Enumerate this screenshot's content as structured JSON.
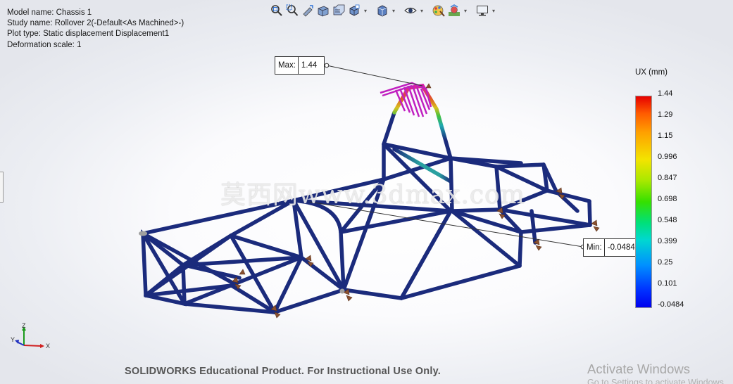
{
  "info": {
    "model_name": "Model name: Chassis 1",
    "study_name": "Study name: Rollover 2(-Default<As Machined>-)",
    "plot_type": "Plot type: Static displacement Displacement1",
    "deformation_scale": "Deformation scale: 1"
  },
  "toolbar": {
    "icons": [
      "zoom-to-fit-icon",
      "zoom-to-area-icon",
      "previous-view-icon",
      "section-view-icon",
      "dynamic-annotation-icon",
      "view-orientation-icon",
      "display-style-icon",
      "hide-show-icon",
      "edit-appearance-icon",
      "apply-scene-icon",
      "view-settings-icon"
    ]
  },
  "callouts": {
    "max_label": "Max:",
    "max_value": "1.44",
    "min_label": "Min:",
    "min_value": "-0.0484"
  },
  "legend": {
    "title": "UX (mm)",
    "ticks": [
      "1.44",
      "1.29",
      "1.15",
      "0.996",
      "0.847",
      "0.698",
      "0.548",
      "0.399",
      "0.25",
      "0.101",
      "-0.0484"
    ]
  },
  "triad": {
    "x": "X",
    "y": "Y",
    "z": "Z"
  },
  "watermark": "莫西网www.3dmax.com",
  "footer": "SOLIDWORKS Educational Product. For Instructional Use Only.",
  "activate": {
    "title": "Activate Windows",
    "subtitle": "Go to Settings to activate Windows."
  },
  "colors": {
    "frame": "#1b2b7c",
    "fixture": "#8a5130",
    "max_region": "#c020c0",
    "min_region": "#2aa0a0"
  }
}
